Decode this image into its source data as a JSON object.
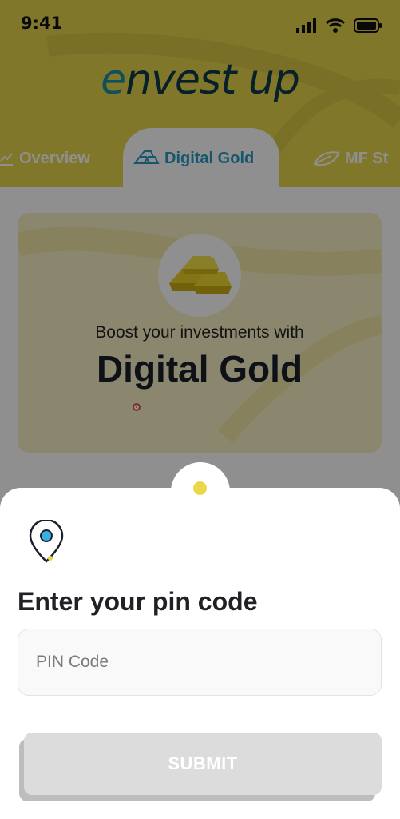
{
  "status_bar": {
    "time": "9:41"
  },
  "logo": {
    "text_e": "e",
    "text_rest": "nvest up"
  },
  "tabs": [
    {
      "label": "Overview",
      "icon": "chart-line-icon"
    },
    {
      "label": "Digital Gold",
      "icon": "gold-bars-icon",
      "active": true
    },
    {
      "label": "MF St",
      "icon": "leaf-icon"
    }
  ],
  "gold_card": {
    "subtitle": "Boost your investments with",
    "title": "Digital Gold"
  },
  "pin_sheet": {
    "icon": "location-pin-icon",
    "title": "Enter your pin code",
    "input_placeholder": "PIN Code",
    "input_value": "",
    "submit_label": "SUBMIT"
  },
  "colors": {
    "header_yellow": "#e7d54c",
    "accent_blue": "#2a9bc4",
    "logo_dark": "#0f3a4a",
    "submit_disabled": "#dcdcdc",
    "notch_dot": "#ead84a"
  }
}
